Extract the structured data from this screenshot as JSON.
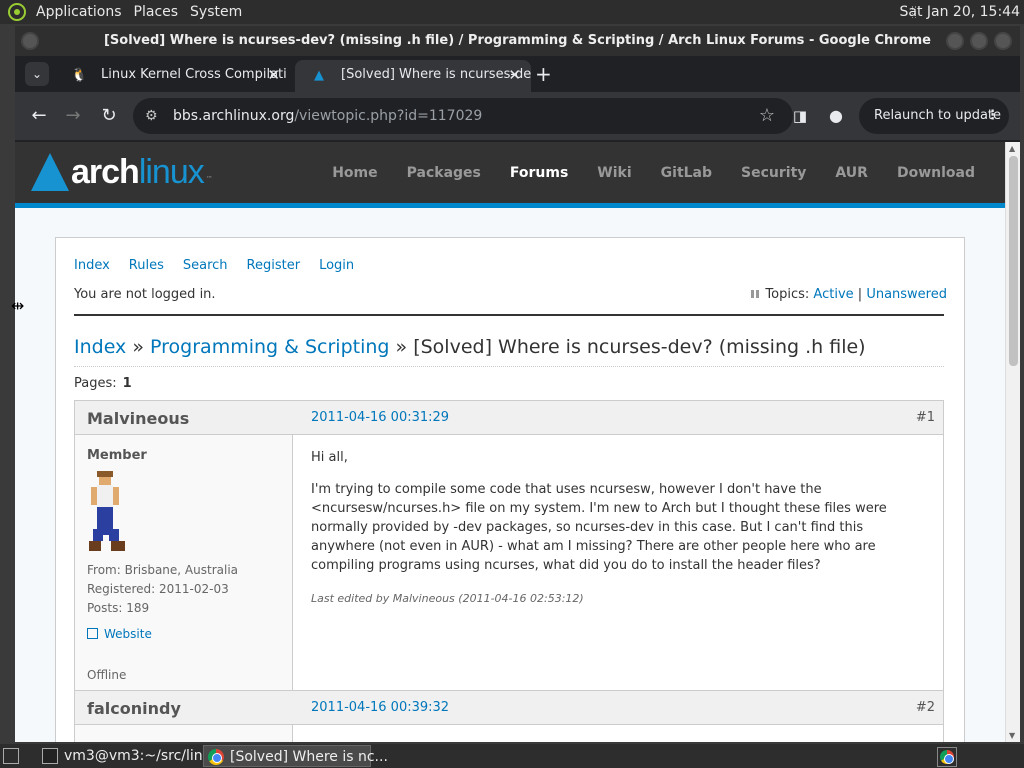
{
  "top_panel": {
    "menus": [
      "Applications",
      "Places",
      "System"
    ],
    "clock": "Sat Jan 20, 15:44"
  },
  "window": {
    "title": "[Solved] Where is ncurses-dev? (missing .h file) / Programming & Scripting / Arch Linux Forums - Google Chrome"
  },
  "tabs": [
    {
      "label": "Linux Kernel Cross Compilati",
      "icon": "penguin-icon"
    },
    {
      "label": "[Solved] Where is ncurses-de",
      "icon": "arch-icon"
    }
  ],
  "toolbar": {
    "url_host": "bbs.archlinux.org",
    "url_path": "/viewtopic.php?id=117029",
    "relaunch_label": "Relaunch to update"
  },
  "arch": {
    "logo_arch": "arch",
    "logo_linux": "linux",
    "logo_tm": "™",
    "nav": [
      "Home",
      "Packages",
      "Forums",
      "Wiki",
      "GitLab",
      "Security",
      "AUR",
      "Download"
    ],
    "active": "Forums"
  },
  "forum": {
    "navlinks": [
      "Index",
      "Rules",
      "Search",
      "Register",
      "Login"
    ],
    "login_status": "You are not logged in.",
    "topics_label": "Topics:",
    "topics_active": "Active",
    "topics_sep": "|",
    "topics_unanswered": "Unanswered",
    "crumb_index": "Index",
    "crumb_sep": "»",
    "crumb_forum": "Programming & Scripting",
    "crumb_topic": "[Solved] Where is ncurses-dev? (missing .h file)",
    "pages_label": "Pages:",
    "pages_value": "1"
  },
  "posts": [
    {
      "author": "Malvineous",
      "date": "2011-04-16 00:31:29",
      "num": "#1",
      "rank": "Member",
      "from": "From: Brisbane, Australia",
      "registered": "Registered: 2011-02-03",
      "posts": "Posts: 189",
      "website": "Website",
      "status": "Offline",
      "greeting": "Hi all,",
      "body": "I'm trying to compile some code that uses ncursesw, however I don't have the <ncursesw/ncurses.h> file on my system.  I'm new to Arch but I thought these files were normally provided by -dev packages, so ncurses-dev in this case.  But I can't find this anywhere (not even in AUR) - what am I missing?  There are other people here who are compiling programs using ncurses, what did you do to install the header files?",
      "edited": "Last edited by Malvineous (2011-04-16 02:53:12)"
    },
    {
      "author": "falconindy",
      "date": "2011-04-16 00:39:32",
      "num": "#2"
    }
  ],
  "taskbar": {
    "term_label": "vm3@vm3:~/src/lin...",
    "chrome_label": "[Solved] Where is nc..."
  }
}
